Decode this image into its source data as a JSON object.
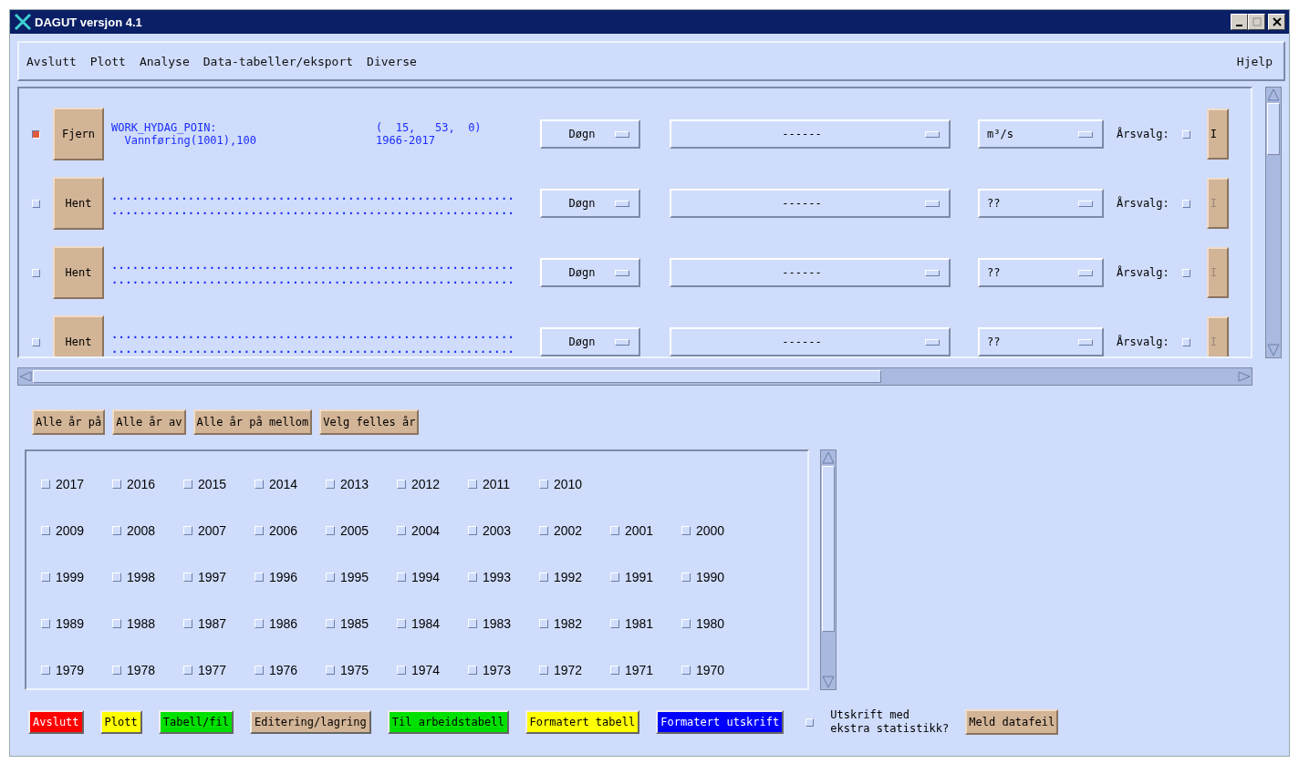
{
  "window": {
    "title": "DAGUT versjon 4.1"
  },
  "menu": {
    "items": [
      "Avslutt",
      "Plott",
      "Analyse",
      "Data-tabeller/eksport",
      "Diverse"
    ],
    "help": "Hjelp"
  },
  "series": [
    {
      "kind": "loaded",
      "on": true,
      "button": "Fjern",
      "line1": "WORK_HYDAG_POIN:",
      "coords": "(  15,   53,  0)",
      "line2": "  Vannføring(1001),100",
      "years": "1966-2017",
      "period": "Døgn",
      "selection": "------",
      "unit": "m³/s",
      "year_label": "Årsvalg:",
      "year_toggle": false,
      "info_button": "I",
      "info_disabled": false
    },
    {
      "kind": "empty",
      "on": false,
      "button": "Hent",
      "line1": "..........................................................",
      "line2": "..........................................................",
      "period": "Døgn",
      "selection": "------",
      "unit": "??",
      "year_label": "Årsvalg:",
      "year_toggle": false,
      "info_button": "I",
      "info_disabled": true
    },
    {
      "kind": "empty",
      "on": false,
      "button": "Hent",
      "line1": "..........................................................",
      "line2": "..........................................................",
      "period": "Døgn",
      "selection": "------",
      "unit": "??",
      "year_label": "Årsvalg:",
      "year_toggle": false,
      "info_button": "I",
      "info_disabled": true
    },
    {
      "kind": "empty",
      "on": false,
      "button": "Hent",
      "line1": "..........................................................",
      "line2": "..........................................................",
      "period": "Døgn",
      "selection": "------",
      "unit": "??",
      "year_label": "Årsvalg:",
      "year_toggle": false,
      "info_button": "I",
      "info_disabled": true
    }
  ],
  "year_buttons": [
    "Alle år på",
    "Alle år av",
    "Alle år på mellom",
    "Velg felles år"
  ],
  "year_rows": [
    [
      {
        "label": "2017",
        "checked": false
      },
      {
        "label": "2016",
        "checked": false
      },
      {
        "label": "2015",
        "checked": false
      },
      {
        "label": "2014",
        "checked": false
      },
      {
        "label": "2013",
        "checked": false
      },
      {
        "label": "2012",
        "checked": false
      },
      {
        "label": "2011",
        "checked": false
      },
      {
        "label": "2010",
        "checked": false
      }
    ],
    [
      {
        "label": "2009",
        "checked": false
      },
      {
        "label": "2008",
        "checked": false
      },
      {
        "label": "2007",
        "checked": false
      },
      {
        "label": "2006",
        "checked": false
      },
      {
        "label": "2005",
        "checked": false
      },
      {
        "label": "2004",
        "checked": false
      },
      {
        "label": "2003",
        "checked": false
      },
      {
        "label": "2002",
        "checked": false
      },
      {
        "label": "2001",
        "checked": false
      },
      {
        "label": "2000",
        "checked": false
      }
    ],
    [
      {
        "label": "1999",
        "checked": false
      },
      {
        "label": "1998",
        "checked": false
      },
      {
        "label": "1997",
        "checked": false
      },
      {
        "label": "1996",
        "checked": false
      },
      {
        "label": "1995",
        "checked": false
      },
      {
        "label": "1994",
        "checked": false
      },
      {
        "label": "1993",
        "checked": false
      },
      {
        "label": "1992",
        "checked": false
      },
      {
        "label": "1991",
        "checked": false
      },
      {
        "label": "1990",
        "checked": false
      }
    ],
    [
      {
        "label": "1989",
        "checked": false
      },
      {
        "label": "1988",
        "checked": false
      },
      {
        "label": "1987",
        "checked": false
      },
      {
        "label": "1986",
        "checked": false
      },
      {
        "label": "1985",
        "checked": false
      },
      {
        "label": "1984",
        "checked": false
      },
      {
        "label": "1983",
        "checked": false
      },
      {
        "label": "1982",
        "checked": false
      },
      {
        "label": "1981",
        "checked": false
      },
      {
        "label": "1980",
        "checked": false
      }
    ],
    [
      {
        "label": "1979",
        "checked": false
      },
      {
        "label": "1978",
        "checked": false
      },
      {
        "label": "1977",
        "checked": false
      },
      {
        "label": "1976",
        "checked": false
      },
      {
        "label": "1975",
        "checked": false
      },
      {
        "label": "1974",
        "checked": false
      },
      {
        "label": "1973",
        "checked": false
      },
      {
        "label": "1972",
        "checked": false
      },
      {
        "label": "1971",
        "checked": false
      },
      {
        "label": "1970",
        "checked": false
      }
    ]
  ],
  "actions": [
    {
      "label": "Avslutt",
      "color": "#ff0000"
    },
    {
      "label": "Plott",
      "color": "#ffff00"
    },
    {
      "label": "Tabell/fil",
      "color": "#00e000"
    },
    {
      "label": "Editering/lagring",
      "color": "#d2b496"
    },
    {
      "label": "Til arbeidstabell",
      "color": "#00e000"
    },
    {
      "label": "Formatert tabell",
      "color": "#ffff00"
    },
    {
      "label": "Formatert utskrift",
      "color": "#0000ff"
    }
  ],
  "statistics_option": {
    "label": "Utskrift med\nekstra statistikk?",
    "checked": false
  },
  "report_button": "Meld datafeil"
}
